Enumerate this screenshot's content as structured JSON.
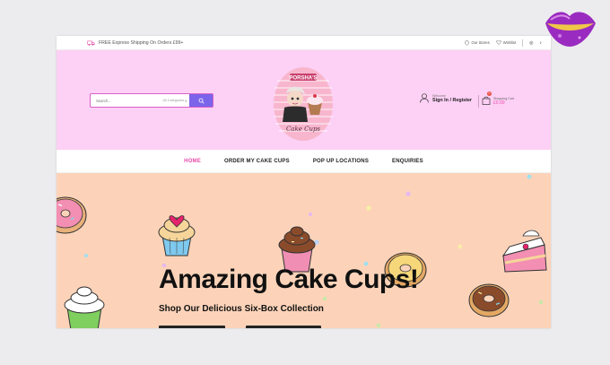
{
  "topbar": {
    "shipping_text": "FREE Express Shipping On Orders £99+",
    "links": [
      {
        "label": "Our Stores",
        "icon": "location-pin-icon"
      },
      {
        "label": "Wishlist",
        "icon": "heart-icon"
      }
    ],
    "social": [
      "instagram-icon",
      "tiktok-icon"
    ]
  },
  "header": {
    "search_placeholder": "Search...",
    "category_label": "All Categories",
    "logo_text": [
      "PORSHA'S",
      "Cake Cups"
    ],
    "account_small": "Welcome",
    "account_big": "Sign In / Register",
    "cart_small": "Shopping Cart",
    "cart_price": "£0.00",
    "cart_count": "0"
  },
  "nav": {
    "items": [
      {
        "label": "HOME",
        "active": true
      },
      {
        "label": "ORDER MY CAKE CUPS",
        "active": false
      },
      {
        "label": "POP UP LOCATIONS",
        "active": false
      },
      {
        "label": "ENQUIRIES",
        "active": false
      }
    ]
  },
  "hero": {
    "title": "Amazing Cake Cups!",
    "subtitle": "Shop Our Delicious Six-Box Collection"
  },
  "colors": {
    "header_bg": "#fdd0f5",
    "hero_bg": "#fcd3b9",
    "accent_pink": "#e84cab",
    "search_button": "#7b63ea"
  }
}
